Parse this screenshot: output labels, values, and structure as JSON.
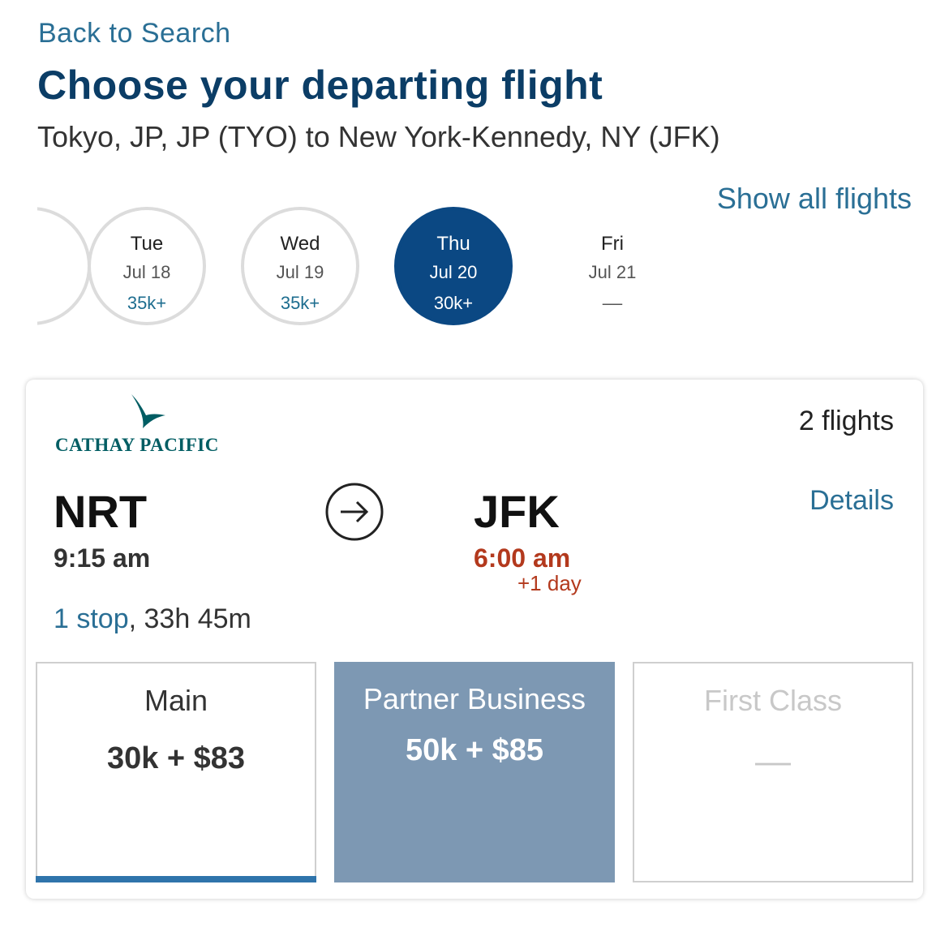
{
  "nav": {
    "back_label": "Back to Search"
  },
  "header": {
    "title": "Choose your departing flight",
    "route": "Tokyo, JP, JP (TYO) to New York-Kennedy, NY (JFK)"
  },
  "show_all_label": "Show all flights",
  "dates": [
    {
      "day": "Tue",
      "date": "Jul 18",
      "price": "35k+",
      "selected": false
    },
    {
      "day": "Wed",
      "date": "Jul 19",
      "price": "35k+",
      "selected": false
    },
    {
      "day": "Thu",
      "date": "Jul 20",
      "price": "30k+",
      "selected": true
    },
    {
      "day": "Fri",
      "date": "Jul 21",
      "price": "––",
      "selected": false
    }
  ],
  "flight": {
    "airline": "CATHAY PACIFIC",
    "airline_logo_icon": "cathay-brushwing-icon",
    "flight_count": "2 flights",
    "details_label": "Details",
    "origin": {
      "code": "NRT",
      "time": "9:15 am"
    },
    "destination": {
      "code": "JFK",
      "time": "6:00 am",
      "day_offset": "+1 day"
    },
    "arrow_icon": "arrow-right-circle-icon",
    "stops_label": "1 stop",
    "duration": ", 33h 45m",
    "fares": [
      {
        "label": "Main",
        "price": "30k + $83",
        "selected": true
      },
      {
        "label": "Partner Business",
        "price": "50k + $85",
        "selected": false
      },
      {
        "label": "First Class",
        "price": "—",
        "available": false
      }
    ]
  },
  "colors": {
    "brand_navy": "#0b3d66",
    "link": "#2a6f95",
    "selected_date": "#0b4883",
    "arrival_warning": "#b3391d",
    "partner_fare_bg": "#7d98b3",
    "main_fare_underline": "#2f74ab",
    "cathay_green": "#005d63"
  }
}
